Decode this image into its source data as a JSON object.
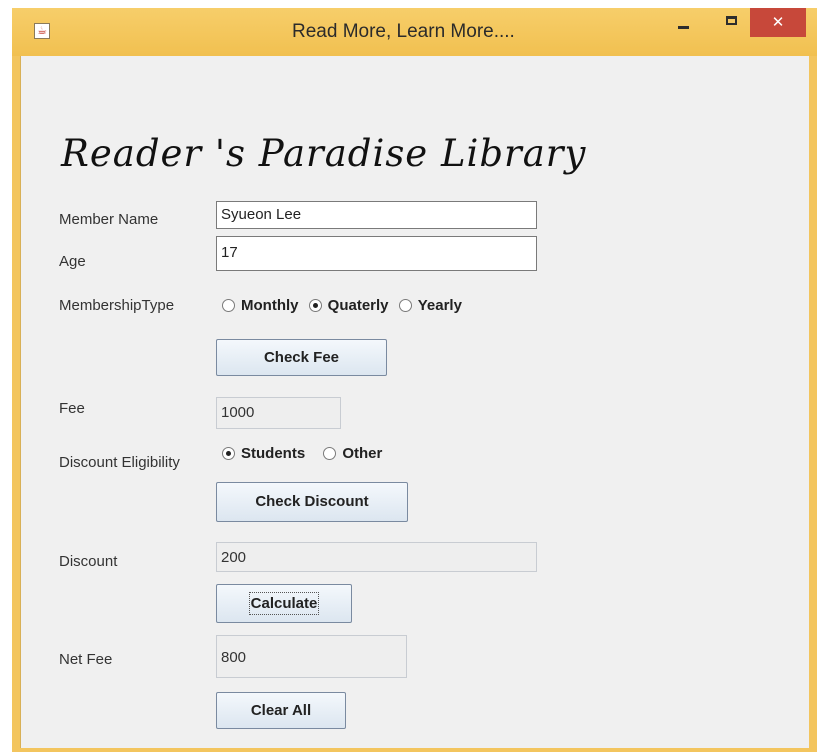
{
  "window": {
    "title": "Read More, Learn More....",
    "close_glyph": "✕"
  },
  "form": {
    "heading": "Reader 's Paradise Library",
    "member_name_label": "Member Name",
    "member_name_value": "Syueon Lee",
    "age_label": "Age",
    "age_value": "17",
    "membership_type_label": "MembershipType",
    "membership_options": [
      {
        "label": "Monthly",
        "selected": false
      },
      {
        "label": "Quaterly",
        "selected": true
      },
      {
        "label": "Yearly",
        "selected": false
      }
    ],
    "check_fee_label": "Check Fee",
    "fee_label": "Fee",
    "fee_value": "1000",
    "discount_eligibility_label": "Discount Eligibility",
    "discount_options": [
      {
        "label": "Students",
        "selected": true
      },
      {
        "label": "Other",
        "selected": false
      }
    ],
    "check_discount_label": "Check Discount",
    "discount_label": "Discount",
    "discount_value": "200",
    "calculate_label": "Calculate",
    "net_fee_label": "Net Fee",
    "net_fee_value": "800",
    "clear_all_label": "Clear All"
  },
  "icons": {
    "app": "java-app-icon",
    "minimize": "minimize-icon",
    "maximize": "maximize-icon",
    "close": "close-icon"
  }
}
